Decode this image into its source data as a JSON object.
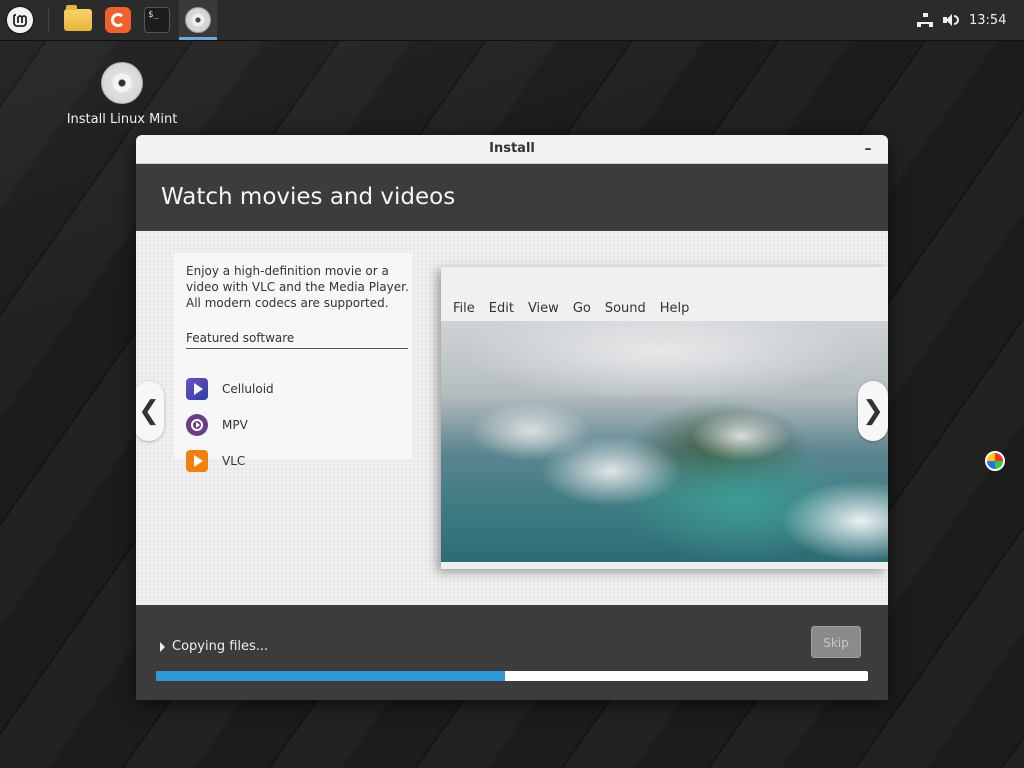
{
  "taskbar": {
    "launchers": [
      "menu-icon",
      "files-icon",
      "firefox-icon",
      "terminal-icon",
      "installer-disc-icon"
    ],
    "terminal_glyph": "$_",
    "clock": "13:54"
  },
  "desktop": {
    "icon_label": "Install Linux Mint"
  },
  "window": {
    "title": "Install",
    "minimize_glyph": "–",
    "heading": "Watch movies and videos",
    "slide": {
      "description": "Enjoy a high-definition movie or a video with VLC and the Media Player. All modern codecs are supported.",
      "featured_label": "Featured software",
      "apps": [
        {
          "name": "Celluloid",
          "icon": "celluloid-icon"
        },
        {
          "name": "MPV",
          "icon": "mpv-icon"
        },
        {
          "name": "VLC",
          "icon": "vlc-icon"
        }
      ],
      "prev_glyph": "❮",
      "next_glyph": "❯",
      "player_menu": [
        "File",
        "Edit",
        "View",
        "Go",
        "Sound",
        "Help"
      ]
    },
    "status_text": "Copying files...",
    "skip_label": "Skip",
    "progress": 0.49,
    "colors": {
      "progress": "#2e97d6",
      "header_bg": "#3c3c3c"
    }
  }
}
